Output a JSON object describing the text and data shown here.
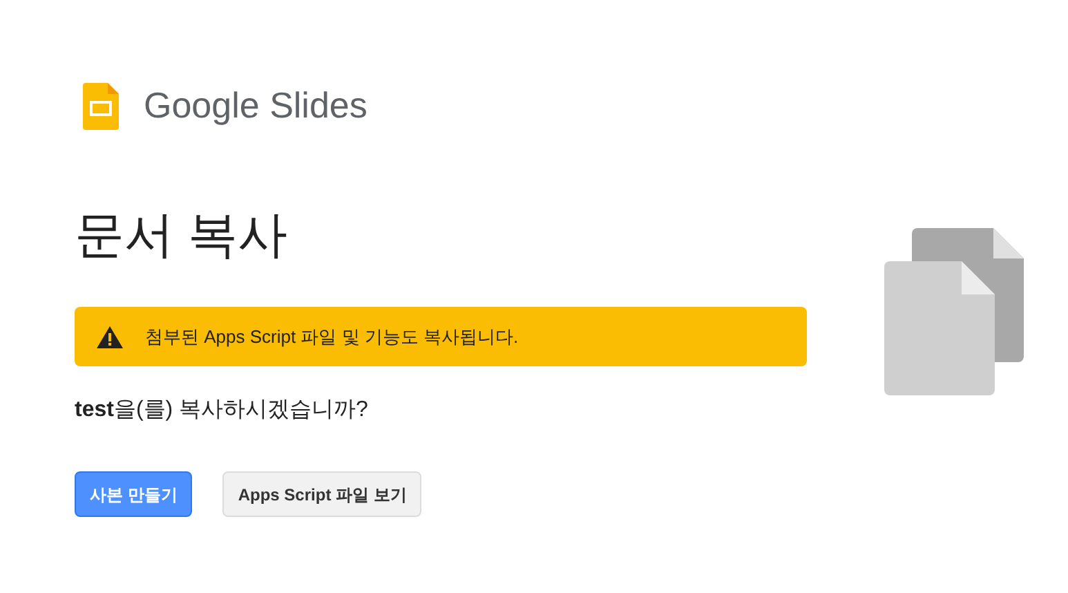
{
  "brand": {
    "name": "Google Slides"
  },
  "title": "문서 복사",
  "warning": {
    "text": "첨부된 Apps Script 파일 및 기능도 복사됩니다."
  },
  "question": "**test**을(를) 복사하시겠습니까?",
  "buttons": [
    {
      "label": "사본 만들기",
      "kind": "primary"
    },
    {
      "label": "Apps Script 파일 보기",
      "kind": "secondary"
    }
  ]
}
